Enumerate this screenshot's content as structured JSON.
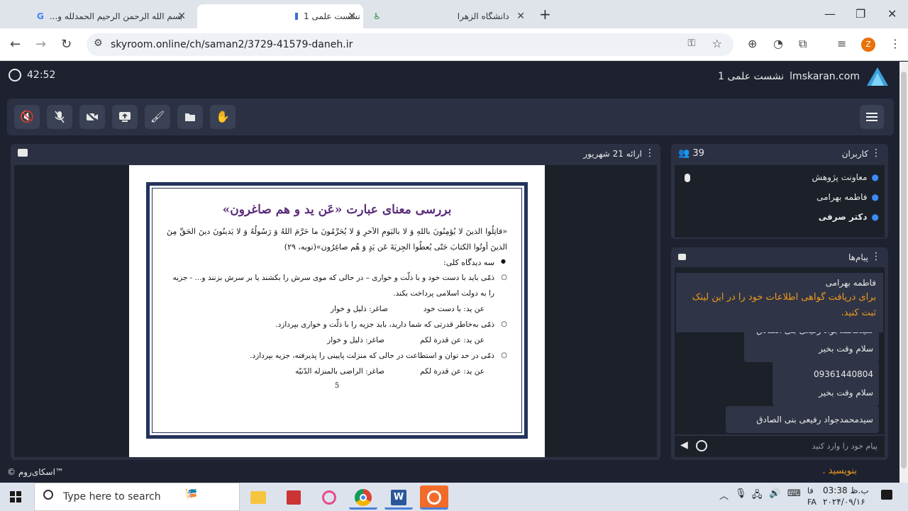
{
  "browser": {
    "tabs": [
      {
        "label": "بسم الله الرحمن الرحیم الحمدلله و...",
        "icon": "google-icon"
      },
      {
        "label": "اسکای‌روم - نشست علمی 1",
        "icon": "skyroom-icon",
        "active": true
      },
      {
        "label": "دانشگاه الزهرا",
        "icon": "alzahra-icon"
      }
    ],
    "new_tab": "+",
    "url": "skyroom.online/ch/saman2/3729-41579-daneh.ir",
    "profile_initial": "Z"
  },
  "app": {
    "timer": "42:52",
    "brand": "lmskaran.com",
    "room_title": "نشست علمی 1",
    "toolbar_buttons": [
      "speaker-muted-icon",
      "mic-muted-icon",
      "camera-off-icon",
      "screen-share-icon",
      "brush-icon",
      "folder-icon",
      "hand-icon"
    ],
    "presentation": {
      "title": "ارائه 21 شهریور",
      "slide": {
        "heading": "بررسی معنای عبارت «عَن ید و هم صاغرون»",
        "verse": "«قاتِلُوا الذینَ لا یُؤمِنُونَ باللهِ وَ لا بالیَومِ الآخرِ وَ لا یُحَرِّمُونَ ما حَرَّمَ اللهُ وَ رَسُولُهُ وَ لا یَدینُونَ دینَ الحَقِّ مِنَ الذینَ أوتُوا الکتابَ حَتّی یُعطُوا الجِزیَةَ عَن یَدٍ وَ هُم صاغِرُون»(توبه، ۲۹)",
        "main_bullet": "سه دیدگاه کلی:",
        "items": [
          {
            "text": "ذمّی باید با دست خود و با ذلّت و خواری – در حالی که موی سرش را بکشند یا بر سرش بزنند و... - جزیه را به دولت اسلامی پرداخت بکند.",
            "a": "عن ید: با دست خود",
            "b": "صاغر: ذلیل و خوار"
          },
          {
            "text": "ذمّی به‌خاطر قدرتی که شما دارید، باید جزیه را با ذلّت و خواری بپردازد.",
            "a": "عن ید: عن قدرة لکم",
            "b": "صاغر: ذلیل و خوار"
          },
          {
            "text": "ذمّی در حد توان و استطاعت در حالی که منزلت پایینی را پذیرفته، جزیه بپردازد.",
            "a": "عن ید: عن قدرة لکم",
            "b": "صاغر: الراضی بالمنزله الدّنیّه"
          }
        ],
        "page_number": "5"
      }
    },
    "users": {
      "title": "کاربران",
      "count": "39",
      "list": [
        "معاونت پژوهش",
        "فاطمه بهرامی",
        "دکتر صرفی"
      ]
    },
    "messages": {
      "title": "پیام‌ها",
      "announcement_name": "فاطمه بهرامی",
      "announcement_text": "برای دریافت گواهی اطلاعات خود را در این لینک ثبت کنید.",
      "items": [
        {
          "name": "سیدمحمدجواد رفیعی بنی الصادق",
          "text": "سلام وقت بخیر"
        },
        {
          "name": "09361440804",
          "text": "سلام وقت بخیر"
        },
        {
          "name": "سیدمحمدجواد رفیعی بنی الصادق",
          "text": ""
        }
      ],
      "input_placeholder": "پیام خود را وارد کنید",
      "overflow_text": "بنویسید ."
    },
    "copyright": "© اسکای‌روم™"
  },
  "taskbar": {
    "search_placeholder": "Type here to search",
    "time": "ب.ظ 03:38",
    "date": "۲۰۲۴/۰۹/۱۶",
    "lang": "فا",
    "lang2": "FA"
  }
}
